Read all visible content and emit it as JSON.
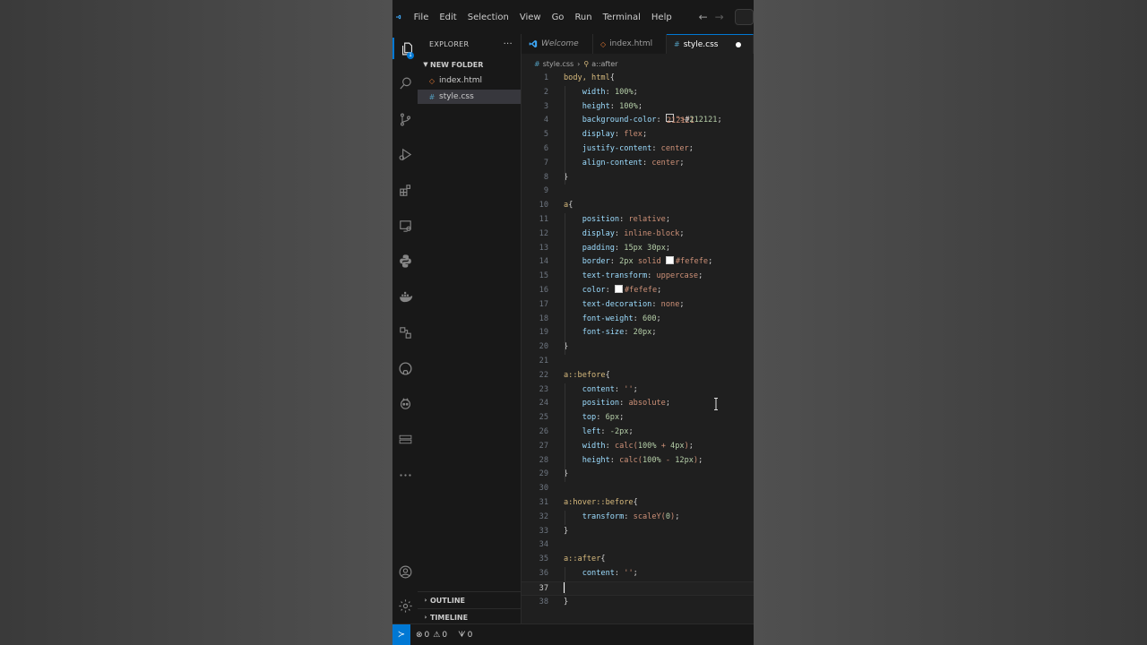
{
  "menu": [
    "File",
    "Edit",
    "Selection",
    "View",
    "Go",
    "Run",
    "Terminal",
    "Help"
  ],
  "sidebar": {
    "title": "EXPLORER",
    "more": "···",
    "folder": "NEW FOLDER",
    "files": [
      {
        "name": "index.html",
        "type": "html"
      },
      {
        "name": "style.css",
        "type": "css",
        "selected": true
      }
    ],
    "outline": "OUTLINE",
    "timeline": "TIMELINE"
  },
  "explorer_badge": "1",
  "tabs": [
    {
      "label": "Welcome",
      "italic": true
    },
    {
      "label": "index.html"
    },
    {
      "label": "style.css",
      "active": true,
      "unsaved": true
    }
  ],
  "breadcrumb": {
    "file": "style.css",
    "symbol": "a::after"
  },
  "code_lines": [
    "body, html{",
    "    width: 100%;",
    "    height: 100%;",
    "    background-color: #212121;",
    "    display: flex;",
    "    justify-content: center;",
    "    align-content: center;",
    "}",
    "",
    "a{",
    "    position: relative;",
    "    display: inline-block;",
    "    padding: 15px 30px;",
    "    border: 2px solid #fefefe;",
    "    text-transform: uppercase;",
    "    color: #fefefe;",
    "    text-decoration: none;",
    "    font-weight: 600;",
    "    font-size: 20px;",
    "}",
    "",
    "a::before{",
    "    content: '';",
    "    position: absolute;",
    "    top: 6px;",
    "    left: -2px;",
    "    width: calc(100% + 4px);",
    "    height: calc(100% - 12px);",
    "}",
    "",
    "a:hover::before{",
    "    transform: scaleY(0);",
    "}",
    "",
    "a::after{",
    "    content: '';",
    "    ",
    "}"
  ],
  "current_line": 37,
  "colors": {
    "accent": "#0078d4",
    "swatch_dark": "#212121",
    "swatch_light": "#fefefe"
  },
  "status": {
    "errors": "0",
    "warnings": "0",
    "ports": "0"
  }
}
